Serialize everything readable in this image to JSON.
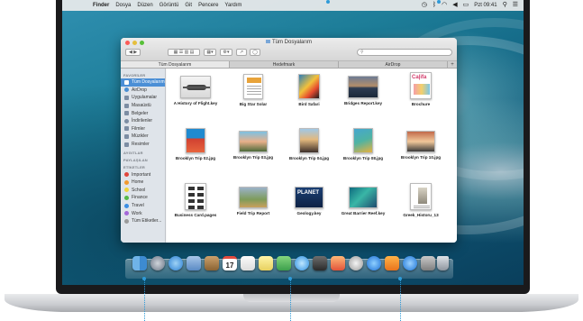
{
  "menubar": {
    "apple_glyph": "",
    "items": [
      "Finder",
      "Dosya",
      "Düzen",
      "Görüntü",
      "Git",
      "Pencere",
      "Yardım"
    ],
    "clock": "Pzt 09:41"
  },
  "window": {
    "title": "Tüm Dosyalarım",
    "search_placeholder": "",
    "tabs": [
      "Tüm Dosyalarım",
      "Hedefmark",
      "AirDrop"
    ],
    "tab_add": "+"
  },
  "sidebar": {
    "section_favorites": "FAVORİLER",
    "favorites": [
      "Tüm Dosyalarım",
      "AirDrop",
      "Uygulamalar",
      "Masaüstü",
      "Belgeler",
      "İndirilenler",
      "Filmler",
      "Müzikler",
      "Resimler"
    ],
    "section_shared": "AYGITLAR",
    "section_sharing": "PAYLAŞILAN",
    "section_tags": "ETİKETLER",
    "tags": [
      {
        "label": "Important",
        "color": "#e0463c"
      },
      {
        "label": "Home",
        "color": "#f29a2e"
      },
      {
        "label": "School",
        "color": "#f0d43a"
      },
      {
        "label": "Finance",
        "color": "#56b947"
      },
      {
        "label": "Travel",
        "color": "#3c8ee3"
      },
      {
        "label": "Work",
        "color": "#a368d9"
      },
      {
        "label": "Tüm Etiketler...",
        "color": "#9a9a9a"
      }
    ]
  },
  "files": [
    {
      "name": "A History of Flight.key"
    },
    {
      "name": "Big Star Solar"
    },
    {
      "name": "Bird Safari"
    },
    {
      "name": "Bridges Report.key"
    },
    {
      "name": "Brochure"
    },
    {
      "name": "Brooklyn Trip 02.jpg"
    },
    {
      "name": "Brooklyn Trip 03.jpg"
    },
    {
      "name": "Brooklyn Trip 04.jpg"
    },
    {
      "name": "Brooklyn Trip 08.jpg"
    },
    {
      "name": "Brooklyn Trip 10.jpg"
    },
    {
      "name": "Business Card.pages"
    },
    {
      "name": "Field Trip Report"
    },
    {
      "name": "Geology.key"
    },
    {
      "name": "Great Barrier Reef.key"
    },
    {
      "name": "Greek_Historu_13"
    }
  ],
  "thumb_texts": {
    "brochure": "Ca|ifa",
    "planet": "PLANET"
  },
  "dock": {
    "calendar_day": "17"
  }
}
